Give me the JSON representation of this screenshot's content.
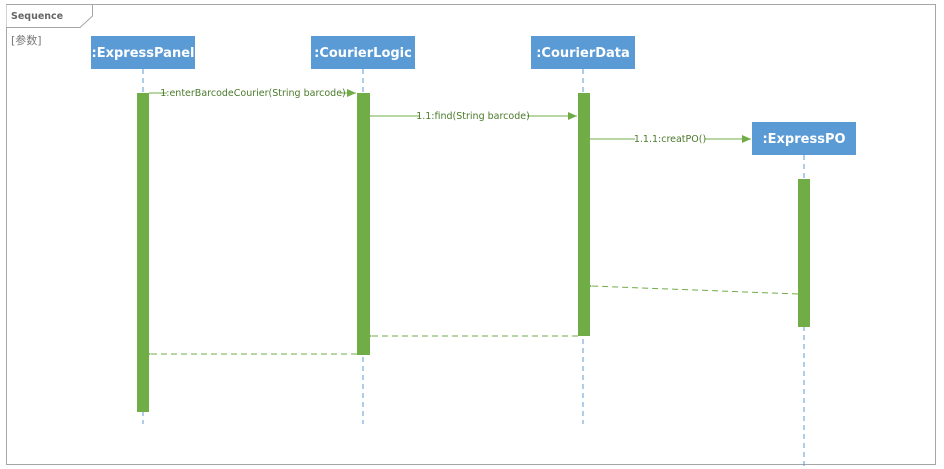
{
  "frame": {
    "tag": "Sequence",
    "parameter": "[参数]"
  },
  "lifelines": [
    {
      "id": "express_panel",
      "label": ":ExpressPanel"
    },
    {
      "id": "courier_logic",
      "label": ":CourierLogic"
    },
    {
      "id": "courier_data",
      "label": ":CourierData"
    },
    {
      "id": "express_po",
      "label": ":ExpressPO"
    }
  ],
  "messages": [
    {
      "label": "1:enterBarcodeCourier(String barcode)",
      "from": "express_panel",
      "to": "courier_logic",
      "kind": "call"
    },
    {
      "label": "1.1:find(String barcode)",
      "from": "courier_logic",
      "to": "courier_data",
      "kind": "call"
    },
    {
      "label": "1.1.1:creatPO()",
      "from": "courier_data",
      "to": "express_po",
      "kind": "create"
    },
    {
      "label": "",
      "from": "express_po",
      "to": "courier_data",
      "kind": "return"
    },
    {
      "label": "",
      "from": "courier_data",
      "to": "courier_logic",
      "kind": "return"
    },
    {
      "label": "",
      "from": "courier_logic",
      "to": "express_panel",
      "kind": "return"
    }
  ],
  "colors": {
    "lifeline_head": "#5b9bd5",
    "activation": "#70ad47",
    "message": "#70ad47",
    "lifeline_dash": "#5b9bd5",
    "frame_border": "#a6a6a6"
  }
}
